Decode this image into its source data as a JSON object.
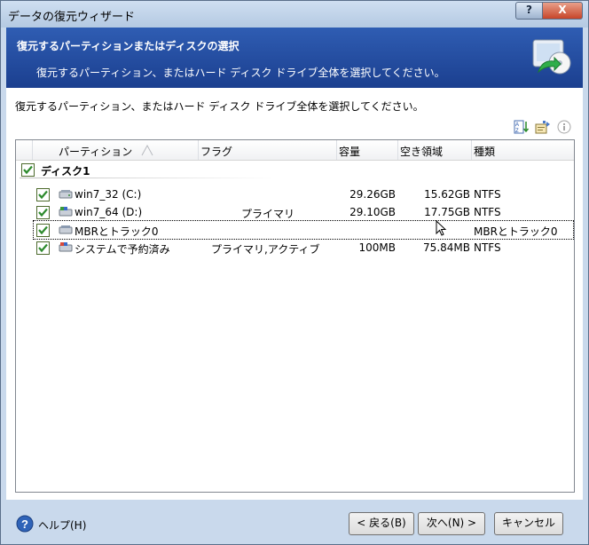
{
  "window": {
    "title": "データの復元ウィザード",
    "help_button": "?",
    "close_button": "X"
  },
  "header": {
    "title": "復元するパーティションまたはディスクの選択",
    "subtitle": "復元するパーティション、またはハード ディスク ドライブ全体を選択してください。"
  },
  "content": {
    "instruction": "復元するパーティション、またはハード ディスク ドライブ全体を選択してください。"
  },
  "table": {
    "columns": [
      "パーティション",
      "フラグ",
      "容量",
      "空き領域",
      "種類"
    ],
    "disk": {
      "label": "ディスク1",
      "checked": true
    },
    "rows": [
      {
        "name": "win7_32 (C:)",
        "flag": "",
        "capacity": "29.26GB",
        "free": "15.62GB",
        "type": "NTFS",
        "checked": true
      },
      {
        "name": "win7_64 (D:)",
        "flag": "プライマリ",
        "capacity": "29.10GB",
        "free": "17.75GB",
        "type": "NTFS",
        "checked": true
      },
      {
        "name": "MBRとトラック0",
        "flag": "",
        "capacity": "",
        "free": "",
        "type": "MBRとトラック0",
        "checked": true
      },
      {
        "name": "システムで予約済み",
        "flag": "プライマリ,アクティブ",
        "capacity": "100MB",
        "free": "75.84MB",
        "type": "NTFS",
        "checked": true
      }
    ]
  },
  "footer": {
    "help": "ヘルプ(H)",
    "back": "< 戻る(B)",
    "next": "次へ(N) >",
    "cancel": "キャンセル"
  },
  "colors": {
    "header_bg": "#1f4698",
    "check_green": "#2e8b2e",
    "frame": "#c9d9ec"
  }
}
